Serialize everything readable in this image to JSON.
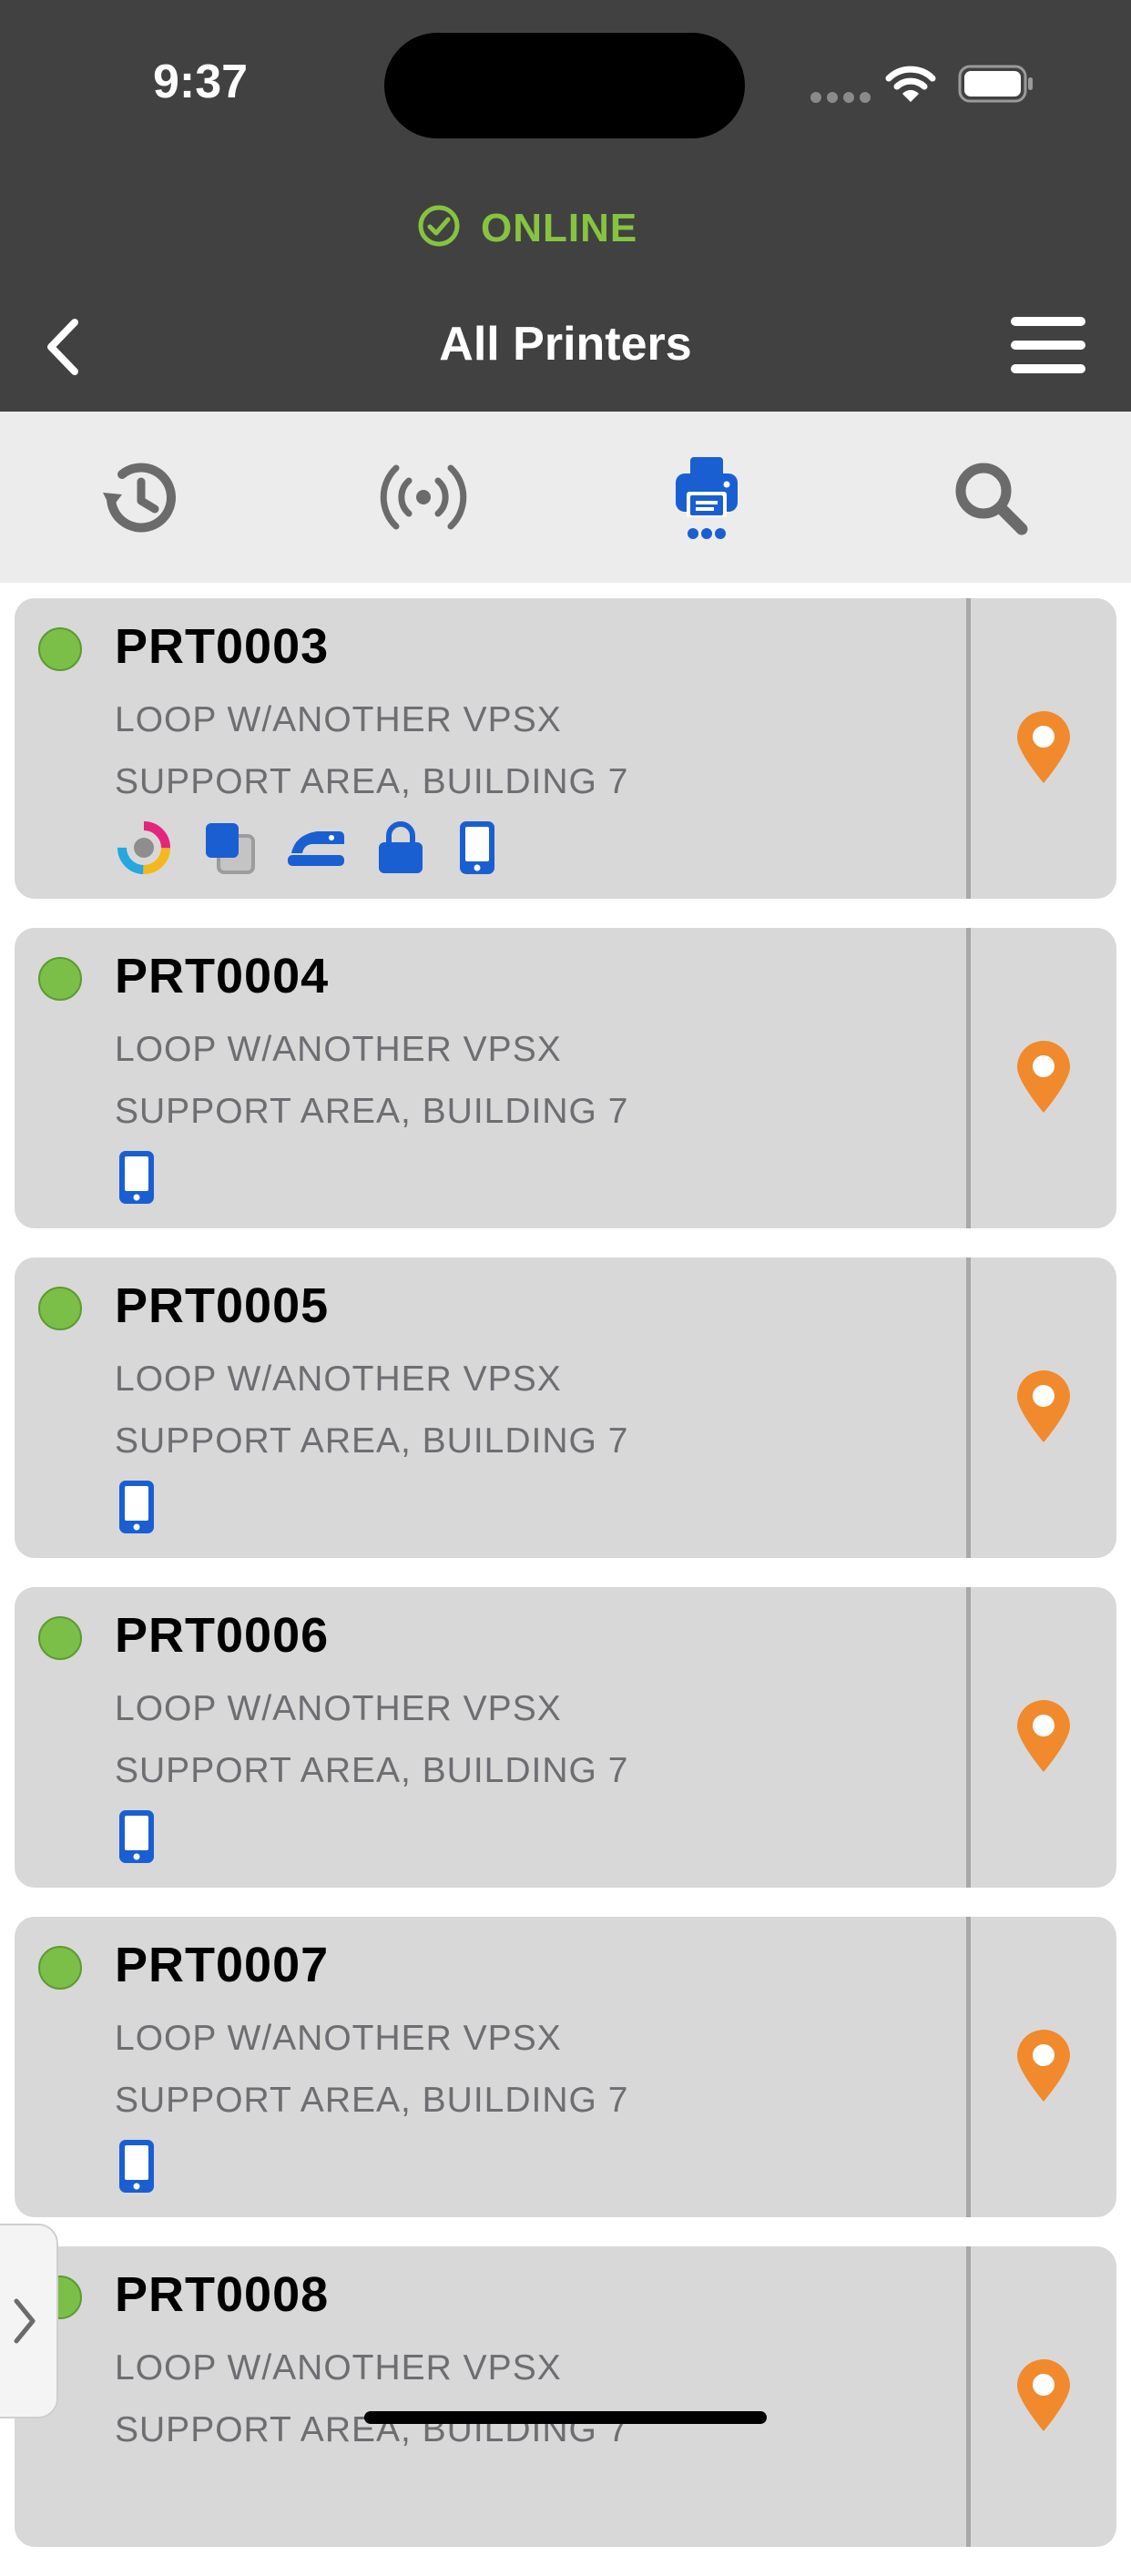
{
  "status_bar": {
    "time": "9:37"
  },
  "connection": {
    "status": "ONLINE",
    "color": "#86c43f"
  },
  "nav": {
    "title": "All Printers",
    "back": "back-icon",
    "menu": "hamburger-menu-icon"
  },
  "tabs": [
    {
      "name": "history",
      "icon": "history-icon",
      "active": false
    },
    {
      "name": "nearby",
      "icon": "broadcast-icon",
      "active": false
    },
    {
      "name": "printers",
      "icon": "printer-icon",
      "active": true
    },
    {
      "name": "search",
      "icon": "search-icon",
      "active": false
    }
  ],
  "colors": {
    "accent": "#1a5fd1",
    "location": "#f08a2c",
    "online": "#7cbf48",
    "header": "#414141"
  },
  "printers": [
    {
      "name": "PRT0003",
      "line1": "LOOP W/ANOTHER VPSX",
      "line2": "SUPPORT AREA, BUILDING 7",
      "features": [
        "color-icon",
        "duplex-icon",
        "staple-icon",
        "secure-lock-icon",
        "mobile-icon"
      ]
    },
    {
      "name": "PRT0004",
      "line1": "LOOP W/ANOTHER VPSX",
      "line2": "SUPPORT AREA, BUILDING 7",
      "features": [
        "mobile-icon"
      ]
    },
    {
      "name": "PRT0005",
      "line1": "LOOP W/ANOTHER VPSX",
      "line2": "SUPPORT AREA, BUILDING 7",
      "features": [
        "mobile-icon"
      ]
    },
    {
      "name": "PRT0006",
      "line1": "LOOP W/ANOTHER VPSX",
      "line2": "SUPPORT AREA, BUILDING 7",
      "features": [
        "mobile-icon"
      ]
    },
    {
      "name": "PRT0007",
      "line1": "LOOP W/ANOTHER VPSX",
      "line2": "SUPPORT AREA, BUILDING 7",
      "features": [
        "mobile-icon"
      ]
    },
    {
      "name": "PRT0008",
      "line1": "LOOP W/ANOTHER VPSX",
      "line2": "SUPPORT AREA, BUILDING 7",
      "features": []
    }
  ]
}
